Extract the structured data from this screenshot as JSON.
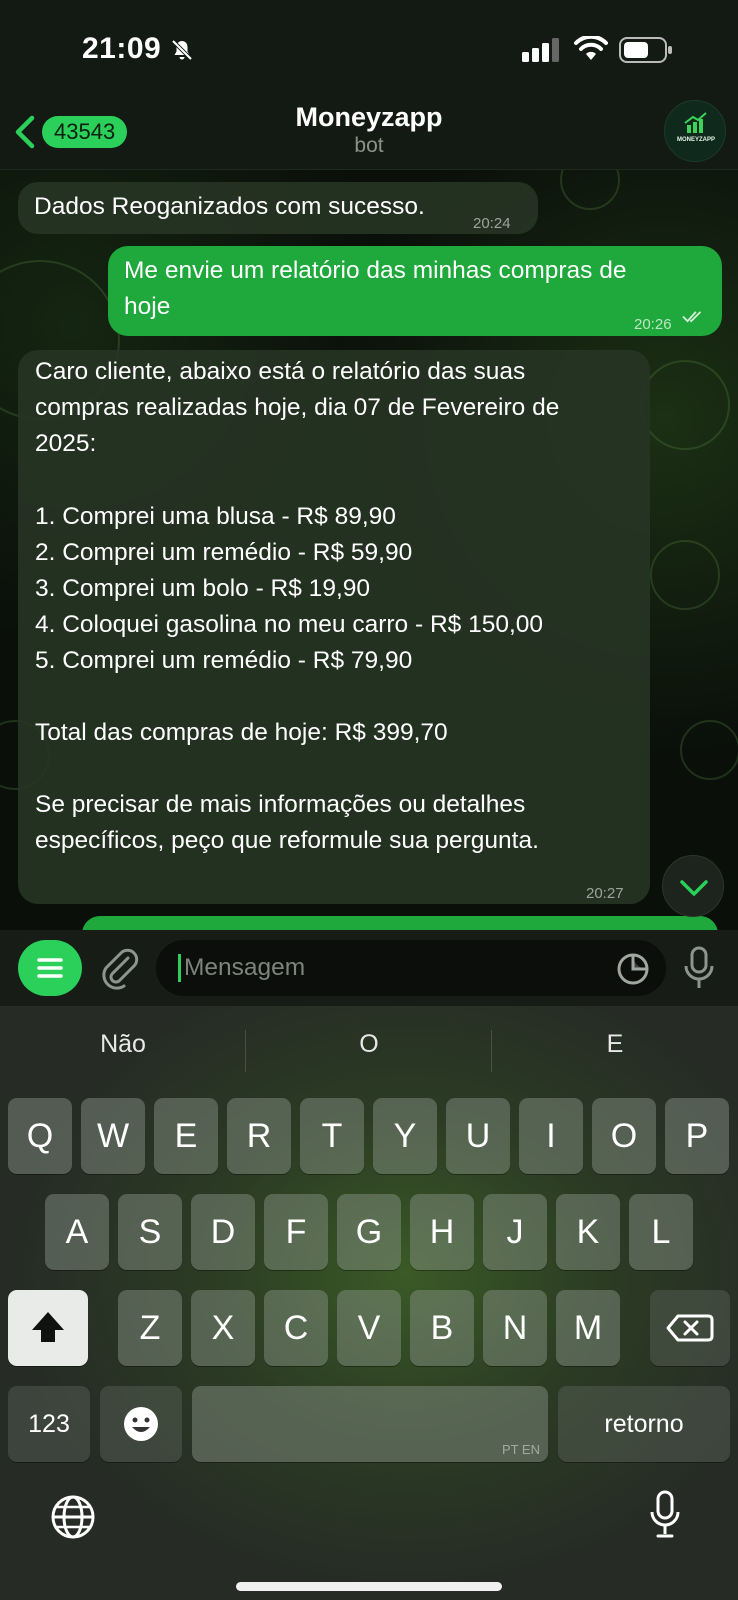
{
  "status_bar": {
    "time": "21:09"
  },
  "header": {
    "unread_count": "43543",
    "title": "Moneyzapp",
    "subtitle": "bot",
    "avatar_label": "MONEYZAPP"
  },
  "messages": [
    {
      "direction": "in",
      "text": "Dados Reoganizados com sucesso.",
      "time": "20:24"
    },
    {
      "direction": "out",
      "lines": [
        "Me envie um relatório das minhas compras de",
        "hoje"
      ],
      "time": "20:26"
    },
    {
      "direction": "in",
      "lines": [
        "Caro cliente, abaixo está o relatório das suas",
        "compras realizadas hoje, dia 07 de Fevereiro de",
        "2025:",
        "",
        "1. Comprei uma blusa - R$ 89,90",
        "2. Comprei um remédio - R$ 59,90",
        "3. Comprei um bolo - R$ 19,90",
        "4. Coloquei gasolina no meu carro - R$ 150,00",
        "5. Comprei um remédio - R$ 79,90",
        "",
        "Total das compras de hoje: R$ 399,70",
        "",
        "Se precisar de mais informações ou detalhes",
        "específicos, peço que reformule sua pergunta."
      ],
      "time": "20:27"
    }
  ],
  "input": {
    "placeholder": "Mensagem"
  },
  "keyboard": {
    "suggestions": [
      "Não",
      "O",
      "E"
    ],
    "row1": [
      "Q",
      "W",
      "E",
      "R",
      "T",
      "Y",
      "U",
      "I",
      "O",
      "P"
    ],
    "row2": [
      "A",
      "S",
      "D",
      "F",
      "G",
      "H",
      "J",
      "K",
      "L"
    ],
    "row3": [
      "Z",
      "X",
      "C",
      "V",
      "B",
      "N",
      "M"
    ],
    "numbers_key": "123",
    "space_lang": "PT EN",
    "return_key": "retorno"
  },
  "colors": {
    "accent": "#2ad05a",
    "outgoing_bubble": "#1fa83b"
  }
}
